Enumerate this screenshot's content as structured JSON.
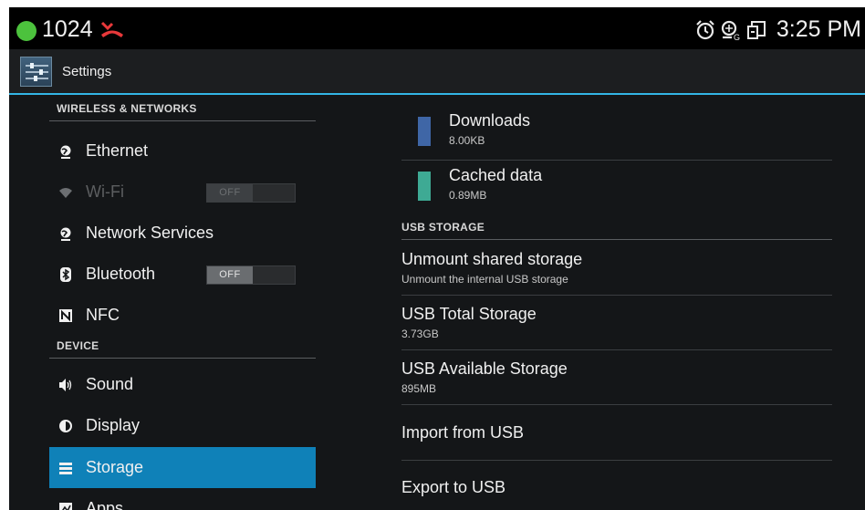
{
  "status_bar": {
    "number": "1024",
    "time": "3:25 PM",
    "icons": [
      "status-dot-icon",
      "missed-call-icon",
      "alarm-icon",
      "location-icon",
      "screen-icon"
    ]
  },
  "action_bar": {
    "title": "Settings",
    "icon": "settings-app-icon"
  },
  "sidebar": {
    "sections": {
      "wireless": "WIRELESS & NETWORKS",
      "device": "DEVICE"
    },
    "items": [
      {
        "label": "Ethernet",
        "icon": "globe-icon"
      },
      {
        "label": "Wi-Fi",
        "icon": "wifi-icon",
        "toggle": "OFF",
        "enabled": false
      },
      {
        "label": "Network Services",
        "icon": "globe-icon"
      },
      {
        "label": "Bluetooth",
        "icon": "bluetooth-icon",
        "toggle": "OFF"
      },
      {
        "label": "NFC",
        "icon": "nfc-icon"
      },
      {
        "label": "Sound",
        "icon": "speaker-icon"
      },
      {
        "label": "Display",
        "icon": "brightness-icon"
      },
      {
        "label": "Storage",
        "icon": "storage-icon",
        "selected": true
      },
      {
        "label": "Apps",
        "icon": "apps-icon"
      }
    ]
  },
  "content": {
    "downloads": {
      "title": "Downloads",
      "value": "8.00KB",
      "color": "#3f66a6"
    },
    "cached": {
      "title": "Cached data",
      "value": "0.89MB",
      "color": "#3eaa94"
    },
    "usb_header": "USB STORAGE",
    "unmount": {
      "title": "Unmount shared storage",
      "sub": "Unmount the internal USB storage"
    },
    "usb_total": {
      "title": "USB Total Storage",
      "value": "3.73GB"
    },
    "usb_available": {
      "title": "USB Available Storage",
      "value": "895MB"
    },
    "import": {
      "title": "Import from USB"
    },
    "export": {
      "title": "Export to USB"
    }
  },
  "colors": {
    "accent": "#33b5e5",
    "selected": "#0f81b8",
    "background": "#141618"
  }
}
